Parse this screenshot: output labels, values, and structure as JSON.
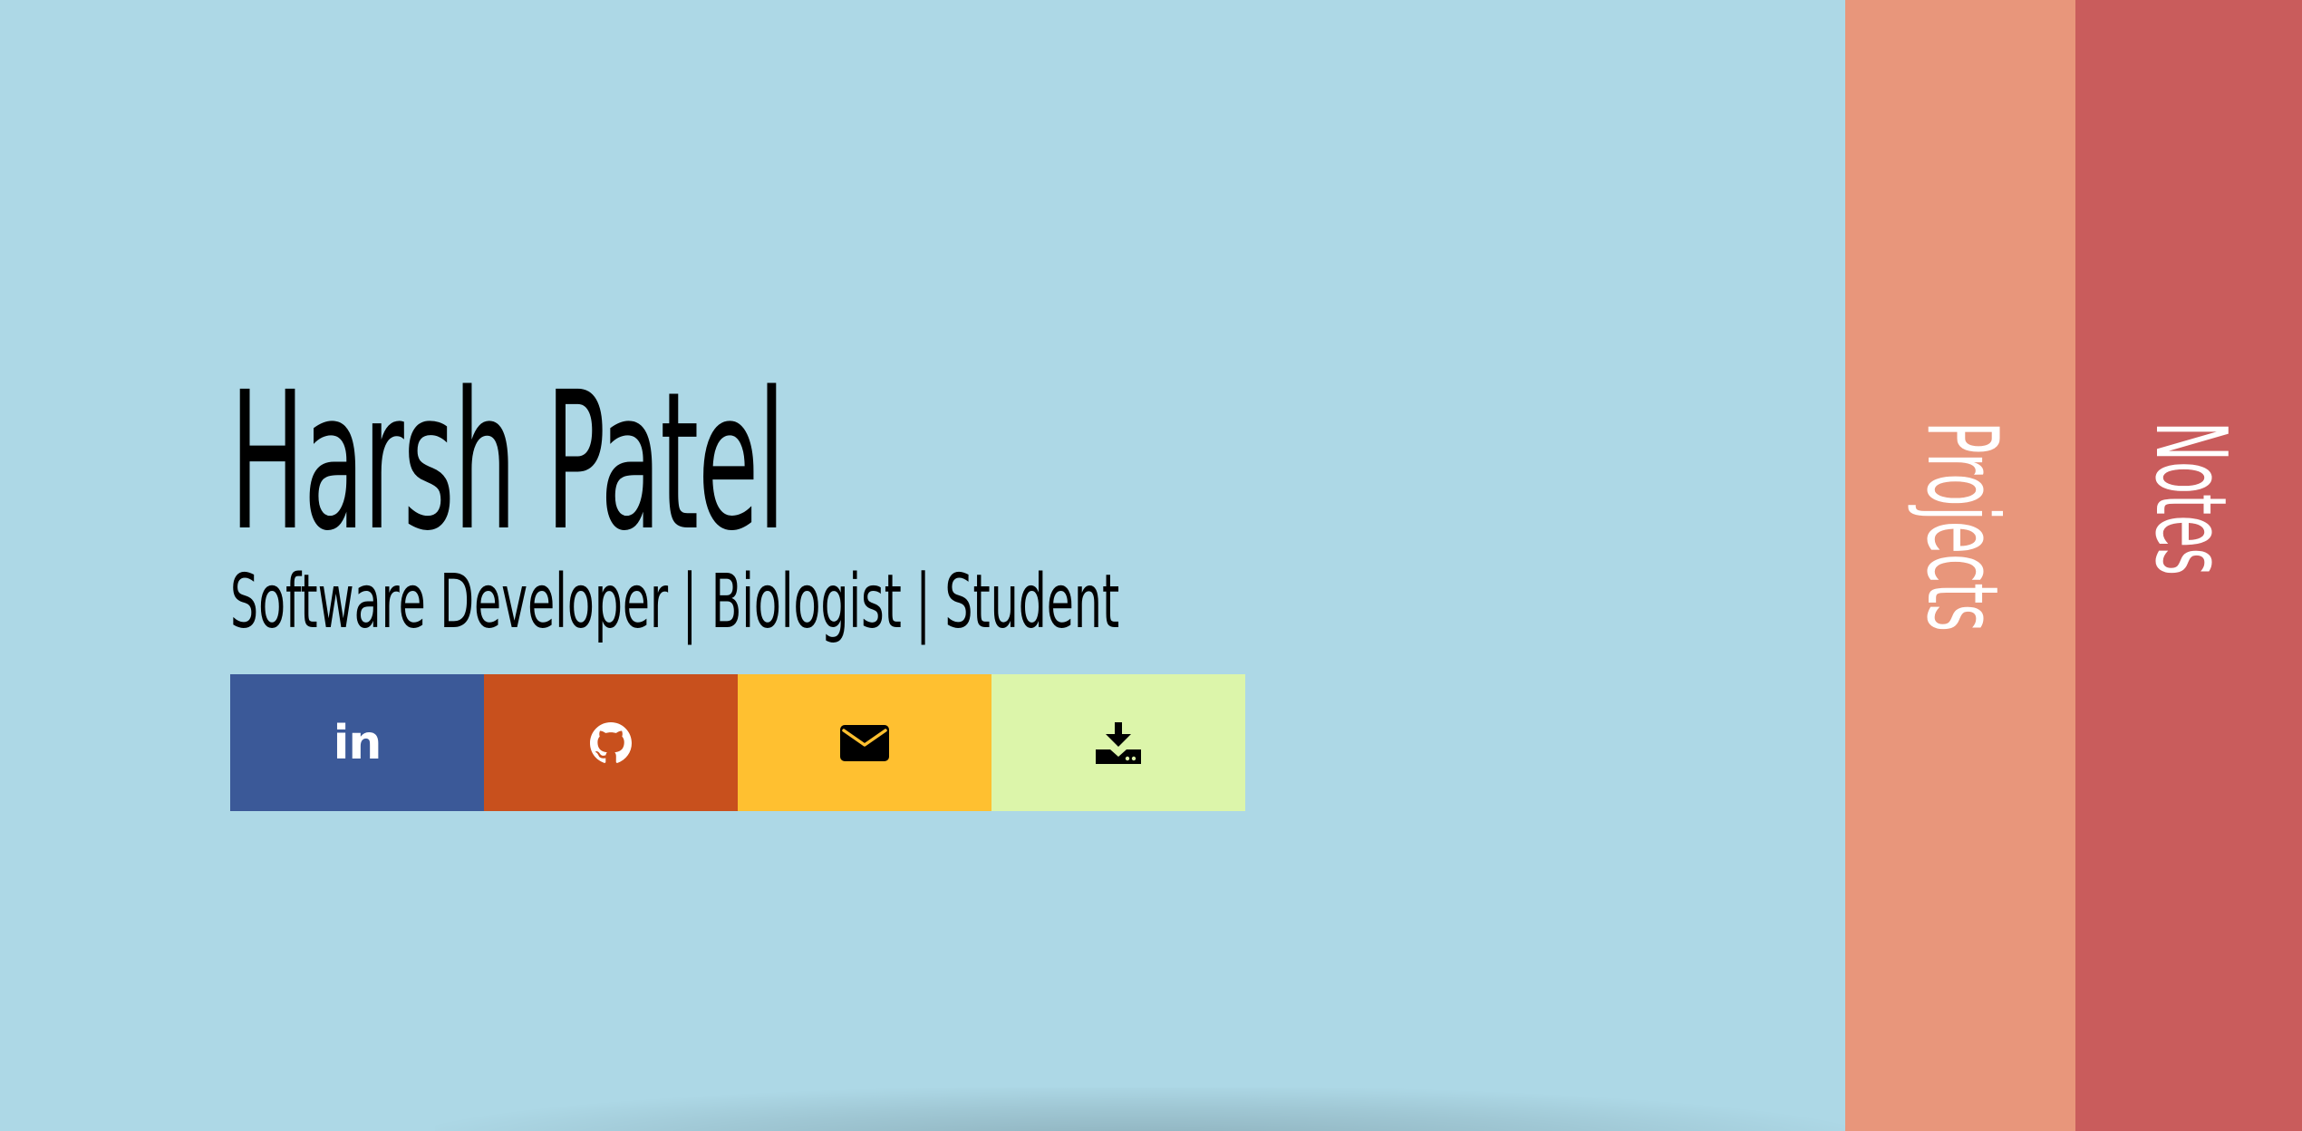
{
  "profile": {
    "name": "Harsh Patel",
    "tagline": "Software Developer | Biologist | Student"
  },
  "social_links": [
    {
      "key": "linkedin",
      "icon": "linkedin-icon",
      "label": "in",
      "bg": "#3b5998",
      "fg": "#ffffff"
    },
    {
      "key": "github",
      "icon": "github-icon",
      "bg": "#c8501d",
      "fg": "#ffffff"
    },
    {
      "key": "email",
      "icon": "envelope-icon",
      "bg": "#ffc030",
      "fg": "#000000"
    },
    {
      "key": "download",
      "icon": "download-icon",
      "bg": "#dcf5aa",
      "fg": "#000000"
    }
  ],
  "nav_tabs": {
    "projects": {
      "label": "Projects",
      "bg": "#e8967b"
    },
    "notes": {
      "label": "Notes",
      "bg": "#c95c5c"
    }
  },
  "colors": {
    "background": "#add8e6",
    "text": "#000000"
  }
}
